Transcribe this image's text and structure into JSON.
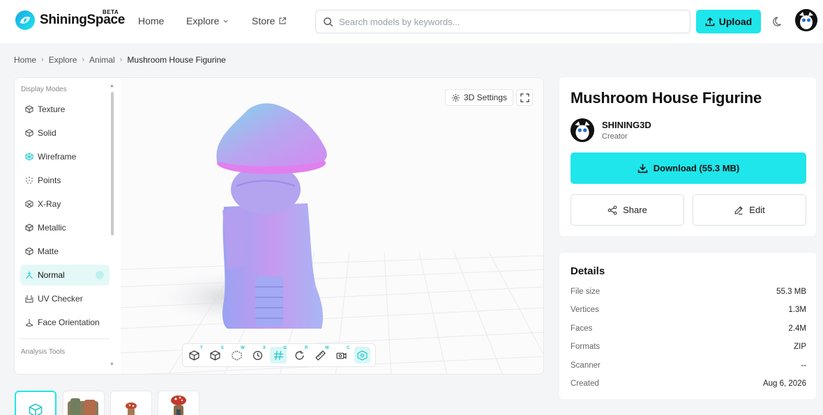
{
  "header": {
    "brand": "ShiningSpace",
    "beta": "BETA",
    "nav": [
      {
        "label": "Home"
      },
      {
        "label": "Explore"
      },
      {
        "label": "Store"
      }
    ],
    "search_placeholder": "Search models by keywords...",
    "upload_label": "Upload",
    "accent": "#1ee6ea"
  },
  "breadcrumb": [
    "Home",
    "Explore",
    "Animal",
    "Mushroom House Figurine"
  ],
  "viewer": {
    "display_modes_title": "Display Modes",
    "modes": [
      "Texture",
      "Solid",
      "Wireframe",
      "Points",
      "X-Ray",
      "Metallic",
      "Matte",
      "Normal",
      "UV Checker",
      "Face Orientation"
    ],
    "active_mode": "Normal",
    "analysis_tools_title": "Analysis Tools",
    "settings_label": "3D Settings",
    "toolbar_keys": [
      "T",
      "S",
      "W",
      "X",
      "G",
      "R",
      "M",
      "C",
      ""
    ]
  },
  "model": {
    "title": "Mushroom House Figurine",
    "creator_name": "SHINING3D",
    "creator_role": "Creator",
    "download_label": "Download (55.3 MB)",
    "share_label": "Share",
    "edit_label": "Edit"
  },
  "details": {
    "title": "Details",
    "rows": [
      {
        "key": "File size",
        "value": "55.3 MB"
      },
      {
        "key": "Vertices",
        "value": "1.3M"
      },
      {
        "key": "Faces",
        "value": "2.4M"
      },
      {
        "key": "Formats",
        "value": "ZIP"
      },
      {
        "key": "Scanner",
        "value": "--"
      },
      {
        "key": "Created",
        "value": "Aug 6, 2026"
      }
    ]
  }
}
